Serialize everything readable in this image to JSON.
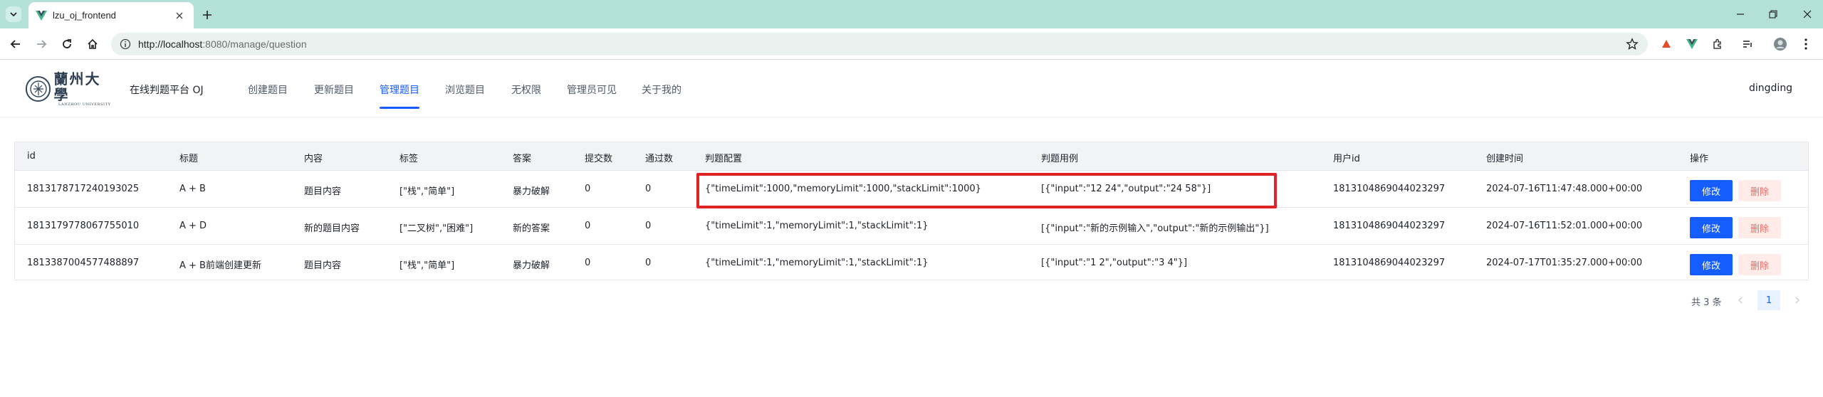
{
  "browser": {
    "tab_title": "lzu_oj_frontend",
    "url_host": "http://localhost",
    "url_path": ":8080/manage/question"
  },
  "header": {
    "logo_cn": "蘭州大學",
    "logo_en": "LANZHOU UNIVERSITY",
    "site_title": "在线判题平台 OJ",
    "menu": [
      "创建题目",
      "更新题目",
      "管理题目",
      "浏览题目",
      "无权限",
      "管理员可见",
      "关于我的"
    ],
    "active_menu": "管理题目",
    "user": "dingding"
  },
  "table": {
    "columns": [
      "id",
      "标题",
      "内容",
      "标签",
      "答案",
      "提交数",
      "通过数",
      "判题配置",
      "判题用例",
      "用户id",
      "创建时间",
      "操作"
    ],
    "rows": [
      {
        "id": "1813178717240193025",
        "title": "A + B",
        "content": "题目内容",
        "tags": "[\"栈\",\"简单\"]",
        "answer": "暴力破解",
        "submit": "0",
        "accepted": "0",
        "judge_config": "{\"timeLimit\":1000,\"memoryLimit\":1000,\"stackLimit\":1000}",
        "judge_case": "[{\"input\":\"12 24\",\"output\":\"24 58\"}]",
        "user_id": "1813104869044023297",
        "create_time": "2024-07-16T11:47:48.000+00:00"
      },
      {
        "id": "1813179778067755010",
        "title": "A + D",
        "content": "新的题目内容",
        "tags": "[\"二叉树\",\"困难\"]",
        "answer": "新的答案",
        "submit": "0",
        "accepted": "0",
        "judge_config": "{\"timeLimit\":1,\"memoryLimit\":1,\"stackLimit\":1}",
        "judge_case": "[{\"input\":\"新的示例输入\",\"output\":\"新的示例输出\"}]",
        "user_id": "1813104869044023297",
        "create_time": "2024-07-16T11:52:01.000+00:00"
      },
      {
        "id": "1813387004577488897",
        "title": "A + B前端创建更新",
        "content": "题目内容",
        "tags": "[\"栈\",\"简单\"]",
        "answer": "暴力破解",
        "submit": "0",
        "accepted": "0",
        "judge_config": "{\"timeLimit\":1,\"memoryLimit\":1,\"stackLimit\":1}",
        "judge_case": "[{\"input\":\"1 2\",\"output\":\"3 4\"}]",
        "user_id": "1813104869044023297",
        "create_time": "2024-07-17T01:35:27.000+00:00"
      }
    ],
    "edit_label": "修改",
    "delete_label": "删除"
  },
  "pagination": {
    "total": "共 3 条",
    "current": "1"
  },
  "colors": {
    "primary": "#165dff",
    "danger_bg": "#ffece8",
    "danger_text": "#f76560",
    "highlight": "#e02424",
    "tabbar": "#b4e0da"
  },
  "icons": [
    "tab-list-icon",
    "vue-logo-icon",
    "close-icon",
    "plus-icon",
    "minimize-icon",
    "restore-icon",
    "back-icon",
    "forward-icon",
    "reload-icon",
    "home-icon",
    "info-icon",
    "star-icon",
    "extension-icon",
    "profile-avatar-icon",
    "more-vert-icon",
    "chevron-left-icon",
    "chevron-right-icon"
  ]
}
